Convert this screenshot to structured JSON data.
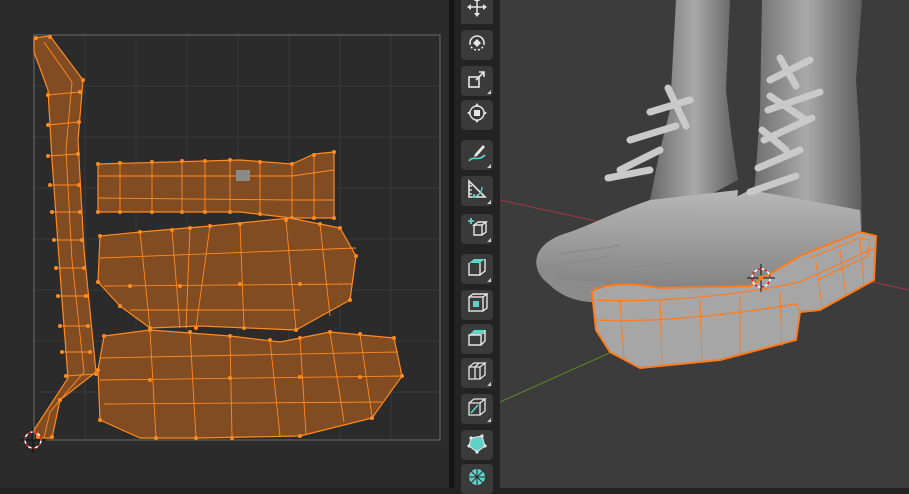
{
  "uv_editor": {
    "grid_color": "#3a3a3a",
    "bounds_color": "#6b6b6b",
    "island_fill": "#8a4f23",
    "island_edge": "#ff8a1f",
    "cursor_icon": "uv-2d-cursor-icon"
  },
  "toolbar": {
    "tools": [
      {
        "name": "move",
        "icon": "move-icon"
      },
      {
        "name": "rotate",
        "icon": "rotate-icon"
      },
      {
        "name": "scale",
        "icon": "scale-icon"
      },
      {
        "name": "transform",
        "icon": "transform-icon"
      },
      {
        "name": "annotate",
        "icon": "annotate-icon"
      },
      {
        "name": "measure",
        "icon": "measure-icon"
      },
      {
        "name": "add-cube",
        "icon": "add-cube-icon"
      },
      {
        "name": "extrude-region",
        "icon": "extrude-region-icon"
      },
      {
        "name": "inset-faces",
        "icon": "inset-faces-icon"
      },
      {
        "name": "bevel",
        "icon": "bevel-icon"
      },
      {
        "name": "loop-cut",
        "icon": "loop-cut-icon"
      },
      {
        "name": "knife",
        "icon": "knife-icon"
      },
      {
        "name": "poly-build",
        "icon": "poly-build-icon"
      },
      {
        "name": "spin",
        "icon": "spin-icon"
      }
    ]
  },
  "viewport": {
    "background": "#3c3c3c",
    "selection_color": "#ff7a1a",
    "axis_x_color": "#9a3a44",
    "axis_y_color": "#5b8a2a",
    "cursor_icon": "3d-cursor-icon"
  }
}
